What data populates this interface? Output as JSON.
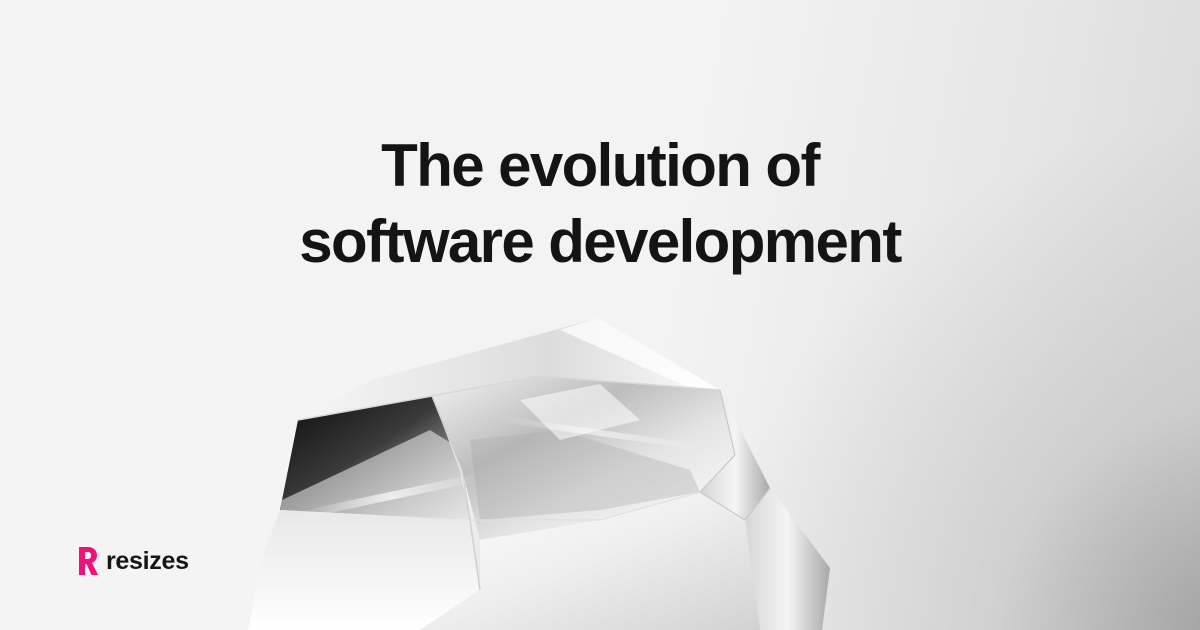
{
  "headline": {
    "line1": "The evolution of",
    "line2": "software development"
  },
  "brand": {
    "name": "resizes",
    "accent_color": "#f0127a",
    "logo_icon": "resizes-logo-icon"
  },
  "illustration": {
    "name": "glass-crystal-illustration"
  },
  "colors": {
    "background": "#f4f4f4",
    "text": "#141414"
  }
}
